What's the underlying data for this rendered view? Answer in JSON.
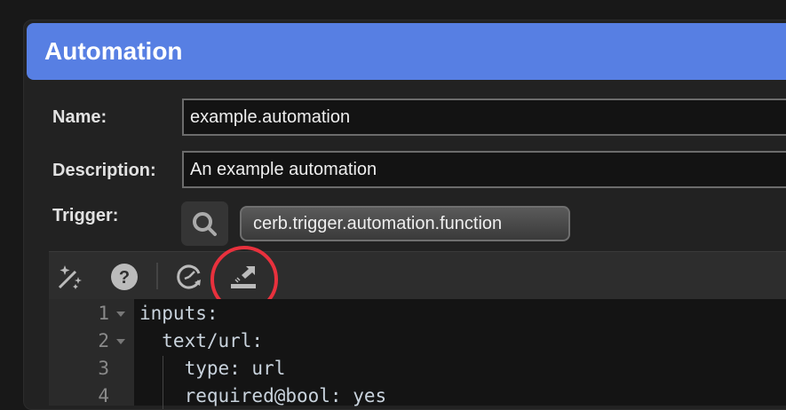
{
  "dialog": {
    "title": "Automation"
  },
  "form": {
    "name_label": "Name:",
    "name_value": "example.automation",
    "description_label": "Description:",
    "description_value": "An example automation",
    "trigger_label": "Trigger:",
    "trigger_value": "cerb.trigger.automation.function"
  },
  "toolbar": {
    "icons": [
      "magic-wand-icon",
      "help-icon",
      "clock-history-icon",
      "export-icon"
    ],
    "highlight_color": "#e8313d"
  },
  "editor": {
    "line_numbers": [
      "1",
      "2",
      "3",
      "4"
    ],
    "lines": [
      "inputs:",
      "  text/url:",
      "    type: url",
      "    required@bool: yes"
    ]
  },
  "colors": {
    "header": "#577fe3"
  }
}
